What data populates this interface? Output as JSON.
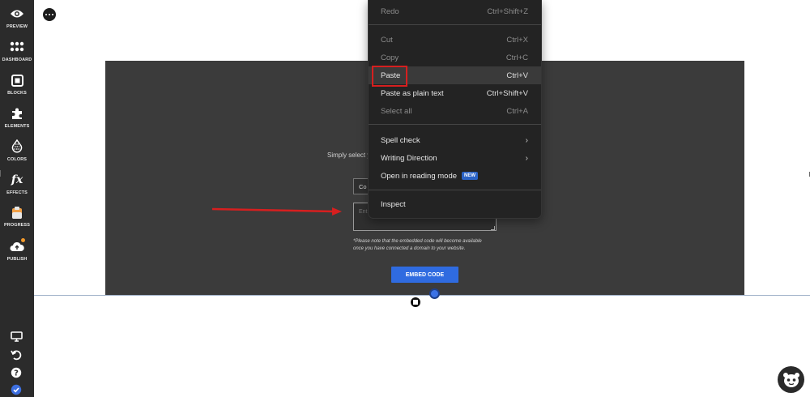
{
  "sidebar": {
    "items": [
      {
        "label": "PREVIEW",
        "icon": "eye-icon"
      },
      {
        "label": "DASHBOARD",
        "icon": "grid-icon"
      },
      {
        "label": "BLOCKS",
        "icon": "blocks-icon"
      },
      {
        "label": "ELEMENTS",
        "icon": "puzzle-icon"
      },
      {
        "label": "COLORS",
        "icon": "colors-icon"
      },
      {
        "label": "EFFECTS",
        "icon": "fx-icon",
        "glyph": "fx"
      },
      {
        "label": "PROGRESS",
        "icon": "clipboard-icon"
      },
      {
        "label": "PUBLISH",
        "icon": "cloud-upload-icon"
      }
    ],
    "bottom_icons": [
      "desktop-icon",
      "undo-icon",
      "help-icon",
      "check-icon"
    ],
    "accent": "#f39a2b"
  },
  "section": {
    "description": "Simply select y",
    "select_value": "Co",
    "textarea_placeholder": "Ent",
    "note_line1": "*Please note that the embedded code will become available",
    "note_line2": "once you have connected a domain to your website.",
    "button_label": "EMBED CODE",
    "button_color": "#2f6be0"
  },
  "context_menu": {
    "items": [
      {
        "label": "Redo",
        "shortcut": "Ctrl+Shift+Z",
        "disabled": true
      },
      {
        "label": "Cut",
        "shortcut": "Ctrl+X",
        "disabled": true
      },
      {
        "label": "Copy",
        "shortcut": "Ctrl+C",
        "disabled": true
      },
      {
        "label": "Paste",
        "shortcut": "Ctrl+V",
        "disabled": false
      },
      {
        "label": "Paste as plain text",
        "shortcut": "Ctrl+Shift+V",
        "disabled": false
      },
      {
        "label": "Select all",
        "shortcut": "Ctrl+A",
        "disabled": true
      },
      {
        "label": "Spell check",
        "submenu": true
      },
      {
        "label": "Writing Direction",
        "submenu": true
      },
      {
        "label": "Open in reading mode",
        "badge": "NEW"
      },
      {
        "label": "Inspect"
      }
    ],
    "highlight_color": "#d61f1f",
    "badge_color": "#2b63c6"
  },
  "annotation_color": "#d61f1f"
}
